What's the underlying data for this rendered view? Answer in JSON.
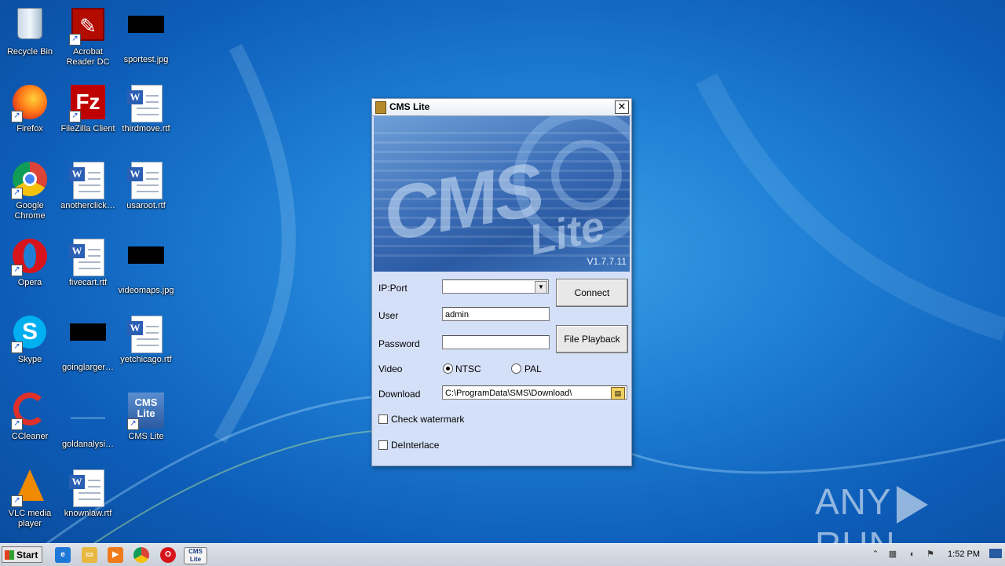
{
  "desktop": {
    "icons": [
      {
        "label": "Recycle Bin",
        "icon": "recycle-bin-icon"
      },
      {
        "label": "Acrobat Reader DC",
        "icon": "acrobat-icon"
      },
      {
        "label": "sportest.jpg",
        "icon": "image-file-icon"
      },
      {
        "label": "Firefox",
        "icon": "firefox-icon"
      },
      {
        "label": "FileZilla Client",
        "icon": "filezilla-icon"
      },
      {
        "label": "thirdmove.rtf",
        "icon": "word-doc-icon"
      },
      {
        "label": "Google Chrome",
        "icon": "chrome-icon"
      },
      {
        "label": "anotherclick…",
        "icon": "word-doc-icon"
      },
      {
        "label": "usaroot.rtf",
        "icon": "word-doc-icon"
      },
      {
        "label": "Opera",
        "icon": "opera-icon"
      },
      {
        "label": "fivecart.rtf",
        "icon": "word-doc-icon"
      },
      {
        "label": "videomaps.jpg",
        "icon": "image-file-icon"
      },
      {
        "label": "Skype",
        "icon": "skype-icon"
      },
      {
        "label": "goinglarger…",
        "icon": "image-file-icon"
      },
      {
        "label": "yetchicago.rtf",
        "icon": "word-doc-icon"
      },
      {
        "label": "CCleaner",
        "icon": "ccleaner-icon"
      },
      {
        "label": "goldanalysi…",
        "icon": "image-file-icon"
      },
      {
        "label": "CMS Lite",
        "icon": "cms-lite-icon"
      },
      {
        "label": "VLC media player",
        "icon": "vlc-icon"
      },
      {
        "label": "knownlaw.rtf",
        "icon": "word-doc-icon"
      }
    ]
  },
  "dialog": {
    "title": "CMS Lite",
    "close_glyph": "✕",
    "banner": {
      "brand": "CMS",
      "sub": "Lite",
      "version": "V1.7.7.11"
    },
    "ip_label": "IP:Port",
    "ip_value": "",
    "user_label": "User",
    "user_value": "admin",
    "password_label": "Password",
    "password_value": "",
    "connect_label": "Connect",
    "playback_label": "File Playback",
    "video_label": "Video",
    "video_options": [
      "NTSC",
      "PAL"
    ],
    "video_selected": "NTSC",
    "download_label": "Download",
    "download_value": "C:\\ProgramData\\SMS\\Download\\",
    "watermark_label": "Check watermark",
    "watermark_checked": false,
    "deinterlace_label": "DeInterlace",
    "deinterlace_checked": false
  },
  "taskbar": {
    "start_label": "Start",
    "clock": "1:52 PM",
    "pinned": [
      "internet-explorer-icon",
      "explorer-icon",
      "media-player-icon",
      "chrome-icon",
      "opera-icon",
      "cms-lite-icon"
    ]
  },
  "watermark": {
    "text_left": "ANY",
    "text_right": "RUN"
  },
  "colors": {
    "dialog_bg": "#d4e0f7",
    "desktop_bg": "#1f7fd4",
    "taskbar_bg": "#d4d9e0"
  }
}
